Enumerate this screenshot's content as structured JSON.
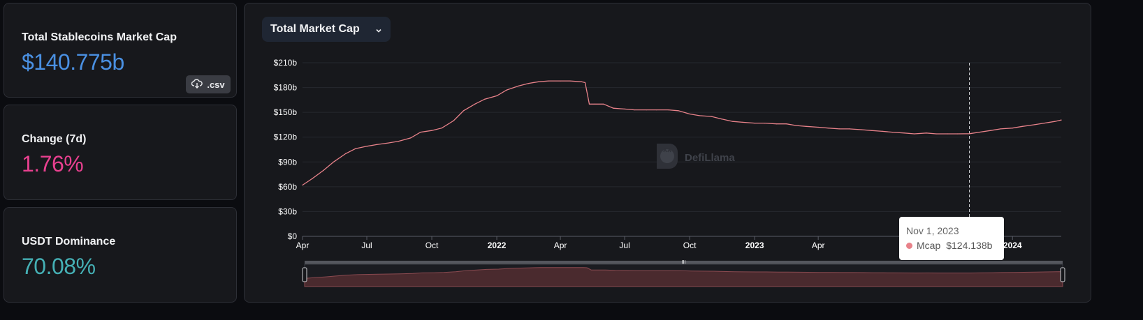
{
  "stats": {
    "mcap_label": "Total Stablecoins Market Cap",
    "mcap_value": "$140.775b",
    "mcap_color": "#4a90e2",
    "csv_label": ".csv",
    "change_label": "Change (7d)",
    "change_value": "1.76%",
    "change_color": "#e8408f",
    "dominance_label": "USDT Dominance",
    "dominance_value": "70.08%",
    "dominance_color": "#45b0b5"
  },
  "selector": {
    "label": "Total Market Cap"
  },
  "watermark": {
    "text": "DefiLlama"
  },
  "tooltip": {
    "date": "Nov 1, 2023",
    "series": "Mcap",
    "value": "$124.138b"
  },
  "chart_data": {
    "type": "line",
    "line_color": "#e8828a",
    "y_ticks": [
      "$0",
      "$30b",
      "$60b",
      "$90b",
      "$120b",
      "$150b",
      "$180b",
      "$210b"
    ],
    "y_tick_values": [
      0,
      30,
      60,
      90,
      120,
      150,
      180,
      210
    ],
    "ylim": [
      0,
      210
    ],
    "x_ticks": [
      {
        "label": "Apr",
        "date": "2021-04-01",
        "bold": false
      },
      {
        "label": "Jul",
        "date": "2021-07-01",
        "bold": false
      },
      {
        "label": "Oct",
        "date": "2021-10-01",
        "bold": false
      },
      {
        "label": "2022",
        "date": "2022-01-01",
        "bold": true
      },
      {
        "label": "Apr",
        "date": "2022-04-01",
        "bold": false
      },
      {
        "label": "Jul",
        "date": "2022-07-01",
        "bold": false
      },
      {
        "label": "Oct",
        "date": "2022-10-01",
        "bold": false
      },
      {
        "label": "2023",
        "date": "2023-01-01",
        "bold": true
      },
      {
        "label": "Apr",
        "date": "2023-04-01",
        "bold": false
      },
      {
        "label": "2024",
        "date": "2024-01-01",
        "bold": true
      }
    ],
    "x_range": [
      "2021-04-01",
      "2024-03-10"
    ],
    "hover_date": "2023-11-01",
    "series": [
      {
        "name": "Mcap",
        "points": [
          [
            "2021-04-01",
            62
          ],
          [
            "2021-04-15",
            70
          ],
          [
            "2021-05-01",
            80
          ],
          [
            "2021-05-15",
            90
          ],
          [
            "2021-06-01",
            100
          ],
          [
            "2021-06-15",
            106
          ],
          [
            "2021-07-01",
            109
          ],
          [
            "2021-07-15",
            111
          ],
          [
            "2021-08-01",
            113
          ],
          [
            "2021-08-15",
            115
          ],
          [
            "2021-09-01",
            119
          ],
          [
            "2021-09-15",
            126
          ],
          [
            "2021-10-01",
            128
          ],
          [
            "2021-10-15",
            131
          ],
          [
            "2021-11-01",
            140
          ],
          [
            "2021-11-15",
            152
          ],
          [
            "2021-12-01",
            160
          ],
          [
            "2021-12-15",
            166
          ],
          [
            "2022-01-01",
            170
          ],
          [
            "2022-01-15",
            177
          ],
          [
            "2022-02-01",
            182
          ],
          [
            "2022-02-15",
            185
          ],
          [
            "2022-03-01",
            187
          ],
          [
            "2022-03-15",
            188
          ],
          [
            "2022-04-01",
            188
          ],
          [
            "2022-04-15",
            188
          ],
          [
            "2022-05-01",
            187
          ],
          [
            "2022-05-06",
            186
          ],
          [
            "2022-05-12",
            160
          ],
          [
            "2022-05-20",
            160
          ],
          [
            "2022-06-01",
            160
          ],
          [
            "2022-06-15",
            155
          ],
          [
            "2022-07-01",
            154
          ],
          [
            "2022-07-15",
            153
          ],
          [
            "2022-08-01",
            153
          ],
          [
            "2022-08-15",
            153
          ],
          [
            "2022-09-01",
            153
          ],
          [
            "2022-09-15",
            152
          ],
          [
            "2022-10-01",
            148
          ],
          [
            "2022-10-15",
            146
          ],
          [
            "2022-11-01",
            145
          ],
          [
            "2022-11-15",
            142
          ],
          [
            "2022-12-01",
            139
          ],
          [
            "2022-12-15",
            138
          ],
          [
            "2023-01-01",
            137
          ],
          [
            "2023-01-15",
            137
          ],
          [
            "2023-02-01",
            136
          ],
          [
            "2023-02-15",
            136
          ],
          [
            "2023-03-01",
            134
          ],
          [
            "2023-03-15",
            133
          ],
          [
            "2023-04-01",
            132
          ],
          [
            "2023-04-15",
            131
          ],
          [
            "2023-05-01",
            130
          ],
          [
            "2023-05-15",
            130
          ],
          [
            "2023-06-01",
            129
          ],
          [
            "2023-06-15",
            128
          ],
          [
            "2023-07-01",
            127
          ],
          [
            "2023-07-15",
            126
          ],
          [
            "2023-08-01",
            125
          ],
          [
            "2023-08-15",
            124
          ],
          [
            "2023-09-01",
            125
          ],
          [
            "2023-09-15",
            124
          ],
          [
            "2023-10-01",
            124
          ],
          [
            "2023-10-15",
            124
          ],
          [
            "2023-11-01",
            124.138
          ],
          [
            "2023-11-15",
            126
          ],
          [
            "2023-12-01",
            128
          ],
          [
            "2023-12-15",
            130
          ],
          [
            "2024-01-01",
            131
          ],
          [
            "2024-01-15",
            133
          ],
          [
            "2024-02-01",
            135
          ],
          [
            "2024-02-15",
            137
          ],
          [
            "2024-03-01",
            139
          ],
          [
            "2024-03-10",
            140.775
          ]
        ]
      }
    ]
  }
}
